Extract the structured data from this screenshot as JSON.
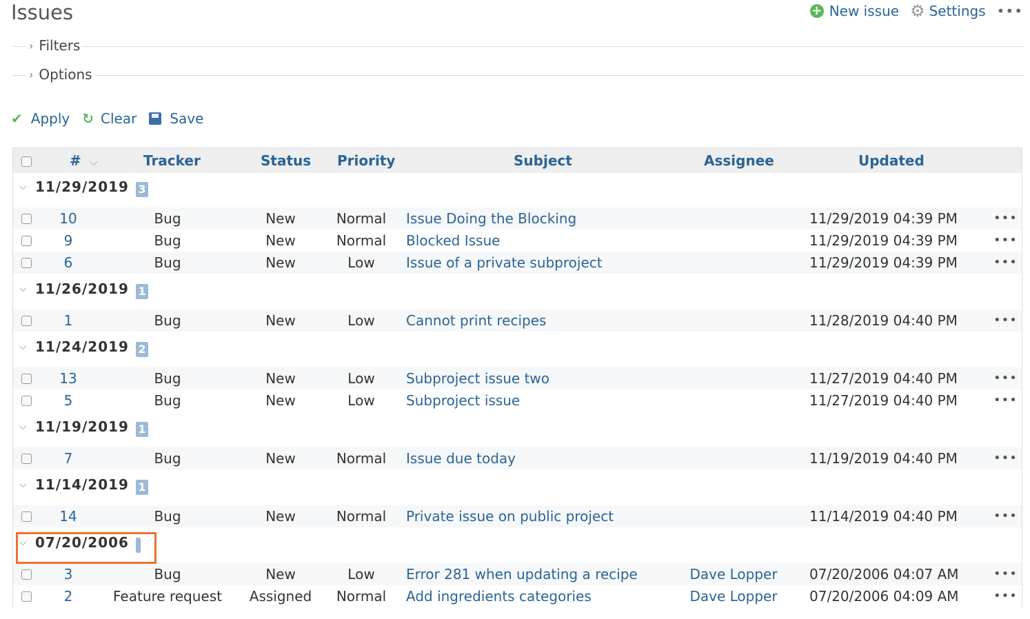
{
  "page": {
    "title": "Issues"
  },
  "top_actions": {
    "new_issue": "New issue",
    "settings": "Settings",
    "more": "•••"
  },
  "filters": {
    "label": "Filters"
  },
  "options": {
    "label": "Options"
  },
  "query_actions": {
    "apply": "Apply",
    "clear": "Clear",
    "save": "Save"
  },
  "table": {
    "headers": {
      "id": "#",
      "tracker": "Tracker",
      "status": "Status",
      "priority": "Priority",
      "subject": "Subject",
      "assignee": "Assignee",
      "updated": "Updated"
    },
    "groups": [
      {
        "label": "11/29/2019",
        "count": "3",
        "rows": [
          {
            "id": "10",
            "tracker": "Bug",
            "status": "New",
            "priority": "Normal",
            "subject": "Issue Doing the Blocking",
            "assignee": "",
            "updated": "11/29/2019 04:39 PM"
          },
          {
            "id": "9",
            "tracker": "Bug",
            "status": "New",
            "priority": "Normal",
            "subject": "Blocked Issue",
            "assignee": "",
            "updated": "11/29/2019 04:39 PM"
          },
          {
            "id": "6",
            "tracker": "Bug",
            "status": "New",
            "priority": "Low",
            "subject": "Issue of a private subproject",
            "assignee": "",
            "updated": "11/29/2019 04:39 PM"
          }
        ]
      },
      {
        "label": "11/26/2019",
        "count": "1",
        "rows": [
          {
            "id": "1",
            "tracker": "Bug",
            "status": "New",
            "priority": "Low",
            "subject": "Cannot print recipes",
            "assignee": "",
            "updated": "11/28/2019 04:40 PM"
          }
        ]
      },
      {
        "label": "11/24/2019",
        "count": "2",
        "rows": [
          {
            "id": "13",
            "tracker": "Bug",
            "status": "New",
            "priority": "Low",
            "subject": "Subproject issue two",
            "assignee": "",
            "updated": "11/27/2019 04:40 PM"
          },
          {
            "id": "5",
            "tracker": "Bug",
            "status": "New",
            "priority": "Low",
            "subject": "Subproject issue",
            "assignee": "",
            "updated": "11/27/2019 04:40 PM"
          }
        ]
      },
      {
        "label": "11/19/2019",
        "count": "1",
        "rows": [
          {
            "id": "7",
            "tracker": "Bug",
            "status": "New",
            "priority": "Normal",
            "subject": "Issue due today",
            "assignee": "",
            "updated": "11/19/2019 04:40 PM"
          }
        ]
      },
      {
        "label": "11/14/2019",
        "count": "1",
        "rows": [
          {
            "id": "14",
            "tracker": "Bug",
            "status": "New",
            "priority": "Normal",
            "subject": "Private issue on public project",
            "assignee": "",
            "updated": "11/14/2019 04:40 PM"
          }
        ]
      },
      {
        "label": "07/20/2006",
        "count": "",
        "rows": [
          {
            "id": "3",
            "tracker": "Bug",
            "status": "New",
            "priority": "Low",
            "subject": "Error 281 when updating a recipe",
            "assignee": "Dave Lopper",
            "updated": "07/20/2006 04:07 AM"
          },
          {
            "id": "2",
            "tracker": "Feature request",
            "status": "Assigned",
            "priority": "Normal",
            "subject": "Add ingredients categories",
            "assignee": "Dave Lopper",
            "updated": "07/20/2006 04:09 AM"
          }
        ]
      }
    ]
  },
  "row_menu_label": "•••",
  "colors": {
    "link": "#2a6496",
    "highlight": "#f07030",
    "badge": "#9db9d5"
  }
}
